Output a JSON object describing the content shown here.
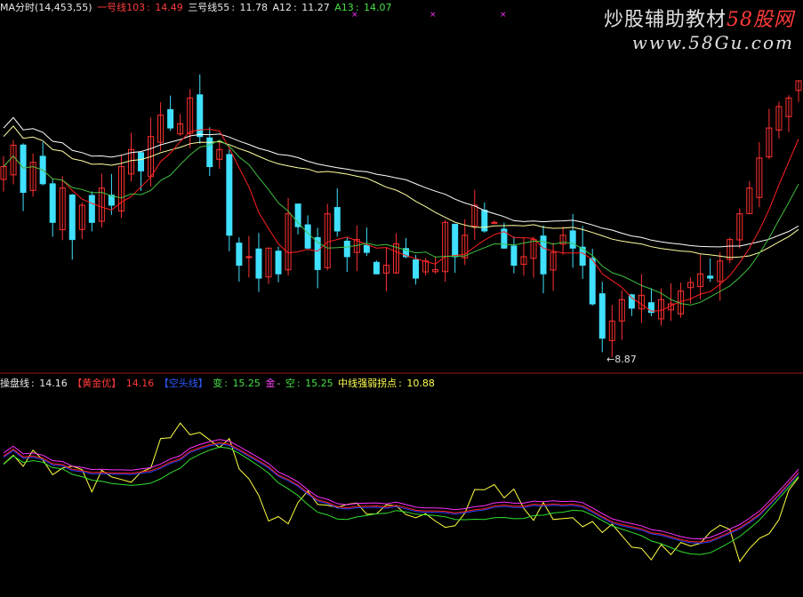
{
  "top_legend": {
    "title": "MA分时(14,453,55)",
    "line1_label": "一号线103",
    "line1_value": "14.49",
    "line3_label": "三号线55",
    "line3_value": "11.78",
    "a12_label": "A12",
    "a12_value": "11.27",
    "a13_label": "A13",
    "a13_value": "14.07"
  },
  "watermark": {
    "title_main": "炒股辅助教材",
    "title_accent": "58股网",
    "url": "www.58Gu.com"
  },
  "bottom_legend": {
    "label_main": "操盘线",
    "value_main": "14.16",
    "label_gold": "【黄金优】",
    "value_gold": "14.16",
    "label_blue": "【空头线】",
    "label_change": "变",
    "value_change": "15.25",
    "label_jin": "金",
    "label_kong": "空",
    "value_kong": "15.25",
    "label_mid": "中线强弱拐点",
    "value_mid": "10.88"
  },
  "low_marker": "8.87",
  "colors": {
    "up": "#ff3030",
    "down": "#40e0ff",
    "ma_white": "#ffffff",
    "ma_yellow": "#ffffa0",
    "ma_red": "#ff2020",
    "ma_green": "#40c040",
    "ind_yellow": "#ffff40",
    "ind_magenta": "#ff30ff",
    "ind_green": "#30e030",
    "ind_blue": "#3040ff",
    "ind_red": "#ff2020",
    "divider": "#a01818"
  },
  "chart_data": [
    {
      "type": "candlestick",
      "title": "MA分时(14,453,55)",
      "series": [
        {
          "name": "一号线103",
          "last": 14.49
        },
        {
          "name": "三号线55",
          "last": 11.78
        },
        {
          "name": "A12",
          "last": 11.27
        },
        {
          "name": "A13",
          "last": 14.07
        }
      ],
      "annotations": [
        {
          "text": "8.87",
          "kind": "low"
        }
      ],
      "closes": [
        12.9,
        13.4,
        12.3,
        13.0,
        12.5,
        11.6,
        12.4,
        11.2,
        12.0,
        11.6,
        12.4,
        12.0,
        12.9,
        13.3,
        12.8,
        13.6,
        14.1,
        13.8,
        13.9,
        14.5,
        13.6,
        12.9,
        13.3,
        11.3,
        10.6,
        10.8,
        10.3,
        11.0,
        10.4,
        11.8,
        11.5,
        11.0,
        10.5,
        11.8,
        11.4,
        10.8,
        11.2,
        10.9,
        10.4,
        10.6,
        11.1,
        10.8,
        10.3,
        10.7,
        10.5,
        11.6,
        10.8,
        11.3,
        12.0,
        11.4,
        11.6,
        11.0,
        10.6,
        10.8,
        11.2,
        10.4,
        10.9,
        11.3,
        11.0,
        10.6,
        9.7,
        8.9,
        9.3,
        9.8,
        9.6,
        9.9,
        9.5,
        9.8,
        9.7,
        10.0,
        10.2,
        10.4,
        10.3,
        10.7,
        11.2,
        11.8,
        12.4,
        13.1,
        13.8,
        14.3,
        14.5,
        14.9
      ]
    },
    {
      "type": "line",
      "title": "操盘线",
      "series": [
        {
          "name": "操盘线",
          "last": 14.16
        },
        {
          "name": "【黄金优】",
          "last": 14.16
        },
        {
          "name": "变",
          "last": 15.25
        },
        {
          "name": "空",
          "last": 15.25
        },
        {
          "name": "中线强弱拐点",
          "last": 10.88
        }
      ]
    }
  ]
}
